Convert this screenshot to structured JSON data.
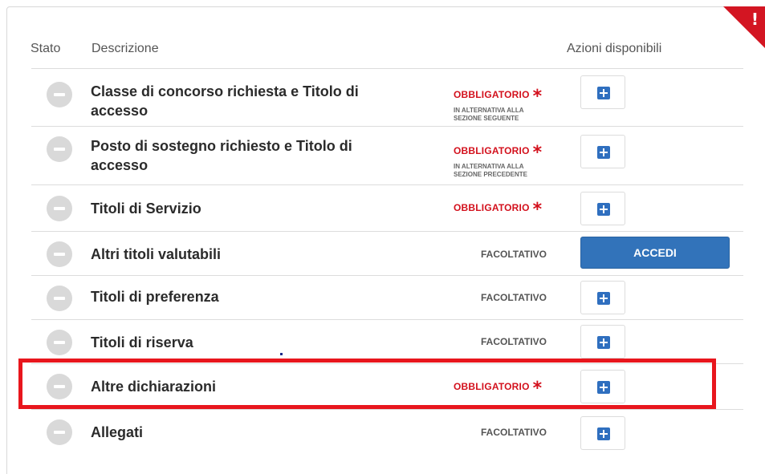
{
  "header": {
    "stato": "Stato",
    "descrizione": "Descrizione",
    "azioni": "Azioni disponibili"
  },
  "corner_flag": {
    "glyph": "!"
  },
  "rows": [
    {
      "label_line1": "Classe di concorso richiesta e Titolo di",
      "label_line2": "accesso",
      "requirement": "OBBLIGATORIO",
      "star": "*",
      "note_line1": "IN ALTERNATIVA ALLA",
      "note_line2": "SEZIONE SEGUENTE",
      "action": "add"
    },
    {
      "label_line1": "Posto di sostegno richiesto e Titolo di",
      "label_line2": "accesso",
      "requirement": "OBBLIGATORIO",
      "star": "*",
      "note_line1": "IN ALTERNATIVA ALLA",
      "note_line2": "SEZIONE PRECEDENTE",
      "action": "add"
    },
    {
      "label": "Titoli di Servizio",
      "requirement": "OBBLIGATORIO",
      "star": "*",
      "action": "add"
    },
    {
      "label": "Altri titoli valutabili",
      "requirement": "FACOLTATIVO",
      "action": "ACCEDI"
    },
    {
      "label": "Titoli di preferenza",
      "requirement": "FACOLTATIVO",
      "action": "add"
    },
    {
      "label": "Titoli di riserva",
      "requirement": "FACOLTATIVO",
      "action": "add"
    },
    {
      "label": "Altre dichiarazioni",
      "requirement": "OBBLIGATORIO",
      "star": "*",
      "action": "add"
    },
    {
      "label": "Allegati",
      "requirement": "FACOLTATIVO",
      "action": "add"
    }
  ],
  "colors": {
    "required_red": "#d3101c",
    "accent_blue": "#3273ba",
    "highlight_red": "#e8161d",
    "status_grey": "#d9d9d9"
  }
}
